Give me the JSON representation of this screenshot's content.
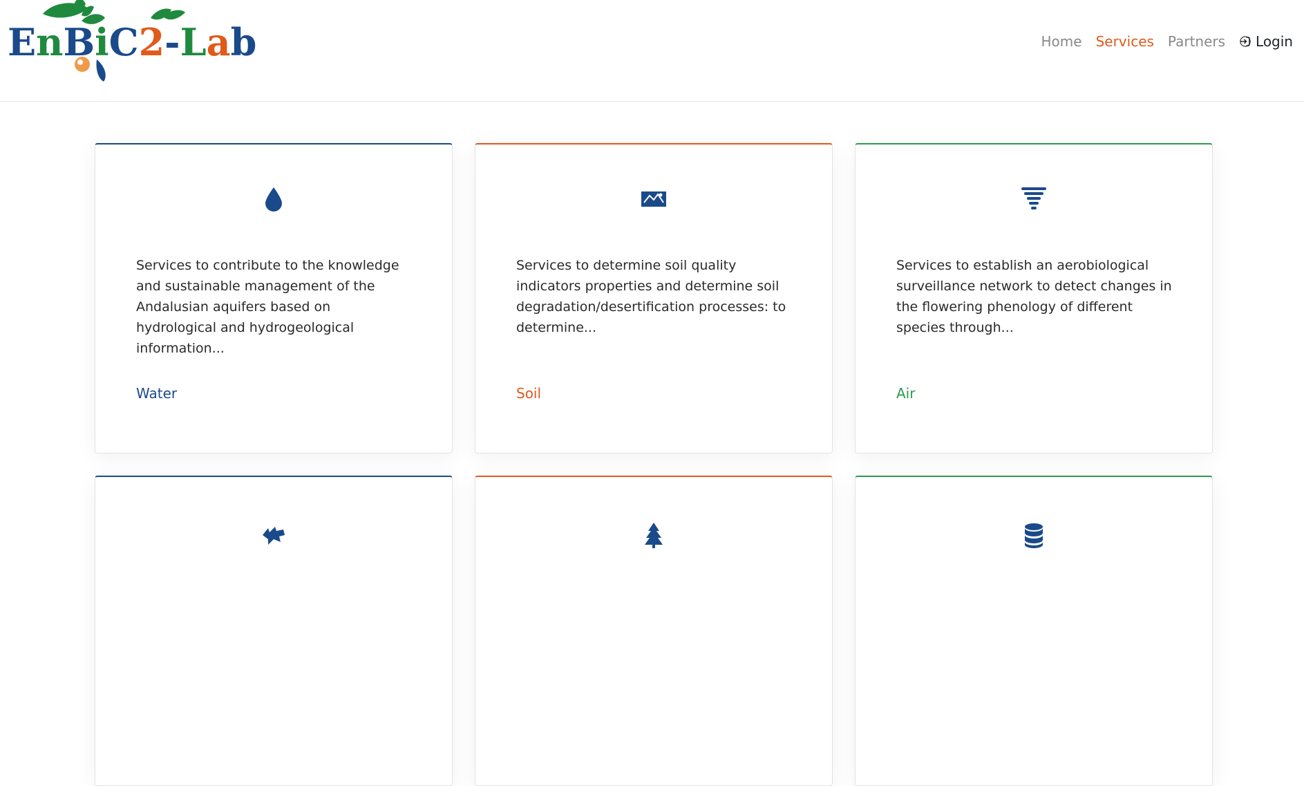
{
  "brand": {
    "letters": [
      "E",
      "n",
      "B",
      "i",
      "C",
      "2",
      "-",
      "L",
      "a",
      "b"
    ],
    "colors": {
      "blue": "#1a4a8a",
      "orange": "#e05a1a",
      "green": "#2e9a4f"
    }
  },
  "nav": {
    "items": [
      {
        "label": "Home",
        "active": false
      },
      {
        "label": "Services",
        "active": true
      },
      {
        "label": "Partners",
        "active": false
      }
    ],
    "login": {
      "label": "Login",
      "icon": "login-icon"
    }
  },
  "cards": [
    {
      "icon": "water-drop-icon",
      "color": "blue",
      "description": "Services to contribute to the knowledge and sustainable management of the Andalusian aquifers based on hydrological and hydrogeological information...",
      "link": "Water"
    },
    {
      "icon": "soil-landscape-icon",
      "color": "orange",
      "description": "Services to determine soil quality indicators properties and determine soil degradation/desertification processes: to determine...",
      "link": "Soil"
    },
    {
      "icon": "tornado-icon",
      "color": "green",
      "description": "Services to establish an aerobiological surveillance network to detect changes in the flowering phenology of different species through...",
      "link": "Air"
    },
    {
      "icon": "wolf-icon",
      "color": "blue"
    },
    {
      "icon": "tree-icon",
      "color": "orange"
    },
    {
      "icon": "database-icon",
      "color": "green"
    }
  ]
}
